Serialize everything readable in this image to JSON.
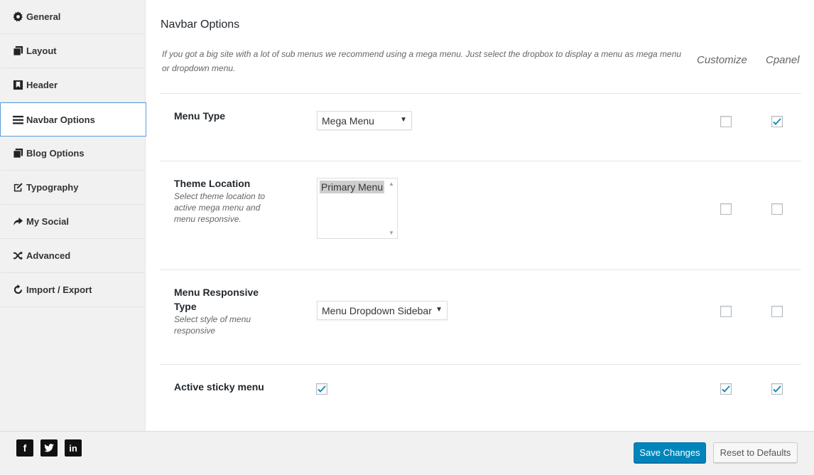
{
  "sidebar": {
    "items": [
      {
        "label": "General",
        "icon": "gear-icon"
      },
      {
        "label": "Layout",
        "icon": "copy-icon"
      },
      {
        "label": "Header",
        "icon": "bookmark-icon"
      },
      {
        "label": "Navbar Options",
        "icon": "menu-bars-icon",
        "active": true
      },
      {
        "label": "Blog Options",
        "icon": "copy-icon"
      },
      {
        "label": "Typography",
        "icon": "edit-icon"
      },
      {
        "label": "My Social",
        "icon": "share-arrow-icon"
      },
      {
        "label": "Advanced",
        "icon": "shuffle-icon"
      },
      {
        "label": "Import / Export",
        "icon": "refresh-icon"
      }
    ]
  },
  "main": {
    "title": "Navbar Options",
    "description": "If you got a big site with a lot of sub menus we recommend using a mega menu. Just select the dropbox to display a menu as mega menu or dropdown menu.",
    "columns": {
      "customize": "Customize",
      "cpanel": "Cpanel"
    },
    "rows": [
      {
        "label": "Menu Type",
        "sub": "",
        "control": "select",
        "value": "Mega Menu",
        "main_checked": null,
        "customize_checked": false,
        "cpanel_checked": true
      },
      {
        "label": "Theme Location",
        "sub": "Select theme location to active mega menu and menu responsive.",
        "control": "listbox",
        "value": "Primary Menu",
        "customize_checked": false,
        "cpanel_checked": false
      },
      {
        "label": "Menu Responsive Type",
        "sub": "Select style of menu responsive",
        "control": "select",
        "value": "Menu Dropdown Sidebar",
        "customize_checked": false,
        "cpanel_checked": false
      },
      {
        "label": "Active sticky menu",
        "sub": "",
        "control": "checkbox",
        "main_checked": true,
        "customize_checked": true,
        "cpanel_checked": true
      }
    ]
  },
  "footer": {
    "social": [
      {
        "name": "facebook",
        "glyph": "f"
      },
      {
        "name": "twitter",
        "glyph": "t"
      },
      {
        "name": "linkedin",
        "glyph": "in"
      }
    ],
    "save_label": "Save Changes",
    "reset_label": "Reset to Defaults"
  },
  "colors": {
    "accent": "#0085ba",
    "check": "#1e8cbe",
    "active_border": "#5b9dd9"
  }
}
